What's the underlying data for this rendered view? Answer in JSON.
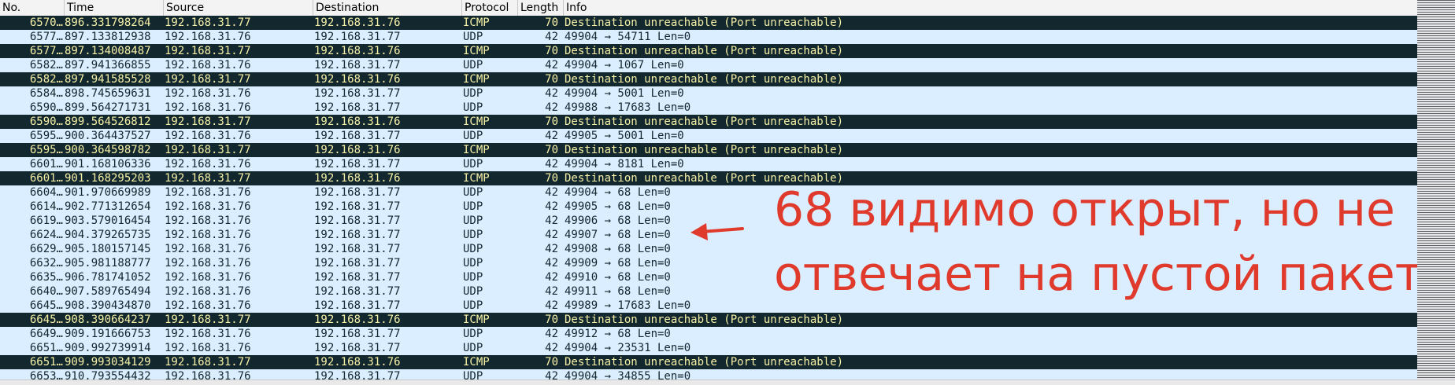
{
  "columns": {
    "no": "No.",
    "time": "Time",
    "source": "Source",
    "destination": "Destination",
    "protocol": "Protocol",
    "length": "Length",
    "info": "Info"
  },
  "packets": [
    {
      "no": "6570…",
      "time": "896.331798264",
      "source": "192.168.31.77",
      "destination": "192.168.31.76",
      "protocol": "ICMP",
      "length": "70",
      "info": "Destination unreachable (Port unreachable)"
    },
    {
      "no": "6577…",
      "time": "897.133812938",
      "source": "192.168.31.76",
      "destination": "192.168.31.77",
      "protocol": "UDP",
      "length": "42",
      "info": "49904 → 54711 Len=0"
    },
    {
      "no": "6577…",
      "time": "897.134008487",
      "source": "192.168.31.77",
      "destination": "192.168.31.76",
      "protocol": "ICMP",
      "length": "70",
      "info": "Destination unreachable (Port unreachable)"
    },
    {
      "no": "6582…",
      "time": "897.941366855",
      "source": "192.168.31.76",
      "destination": "192.168.31.77",
      "protocol": "UDP",
      "length": "42",
      "info": "49904 → 1067 Len=0"
    },
    {
      "no": "6582…",
      "time": "897.941585528",
      "source": "192.168.31.77",
      "destination": "192.168.31.76",
      "protocol": "ICMP",
      "length": "70",
      "info": "Destination unreachable (Port unreachable)"
    },
    {
      "no": "6584…",
      "time": "898.745659631",
      "source": "192.168.31.76",
      "destination": "192.168.31.77",
      "protocol": "UDP",
      "length": "42",
      "info": "49904 → 5001 Len=0"
    },
    {
      "no": "6590…",
      "time": "899.564271731",
      "source": "192.168.31.76",
      "destination": "192.168.31.77",
      "protocol": "UDP",
      "length": "42",
      "info": "49988 → 17683 Len=0"
    },
    {
      "no": "6590…",
      "time": "899.564526812",
      "source": "192.168.31.77",
      "destination": "192.168.31.76",
      "protocol": "ICMP",
      "length": "70",
      "info": "Destination unreachable (Port unreachable)"
    },
    {
      "no": "6595…",
      "time": "900.364437527",
      "source": "192.168.31.76",
      "destination": "192.168.31.77",
      "protocol": "UDP",
      "length": "42",
      "info": "49905 → 5001 Len=0"
    },
    {
      "no": "6595…",
      "time": "900.364598782",
      "source": "192.168.31.77",
      "destination": "192.168.31.76",
      "protocol": "ICMP",
      "length": "70",
      "info": "Destination unreachable (Port unreachable)"
    },
    {
      "no": "6601…",
      "time": "901.168106336",
      "source": "192.168.31.76",
      "destination": "192.168.31.77",
      "protocol": "UDP",
      "length": "42",
      "info": "49904 → 8181 Len=0"
    },
    {
      "no": "6601…",
      "time": "901.168295203",
      "source": "192.168.31.77",
      "destination": "192.168.31.76",
      "protocol": "ICMP",
      "length": "70",
      "info": "Destination unreachable (Port unreachable)"
    },
    {
      "no": "6604…",
      "time": "901.970669989",
      "source": "192.168.31.76",
      "destination": "192.168.31.77",
      "protocol": "UDP",
      "length": "42",
      "info": "49904 → 68 Len=0"
    },
    {
      "no": "6614…",
      "time": "902.771312654",
      "source": "192.168.31.76",
      "destination": "192.168.31.77",
      "protocol": "UDP",
      "length": "42",
      "info": "49905 → 68 Len=0"
    },
    {
      "no": "6619…",
      "time": "903.579016454",
      "source": "192.168.31.76",
      "destination": "192.168.31.77",
      "protocol": "UDP",
      "length": "42",
      "info": "49906 → 68 Len=0"
    },
    {
      "no": "6624…",
      "time": "904.379265735",
      "source": "192.168.31.76",
      "destination": "192.168.31.77",
      "protocol": "UDP",
      "length": "42",
      "info": "49907 → 68 Len=0"
    },
    {
      "no": "6629…",
      "time": "905.180157145",
      "source": "192.168.31.76",
      "destination": "192.168.31.77",
      "protocol": "UDP",
      "length": "42",
      "info": "49908 → 68 Len=0"
    },
    {
      "no": "6632…",
      "time": "905.981188777",
      "source": "192.168.31.76",
      "destination": "192.168.31.77",
      "protocol": "UDP",
      "length": "42",
      "info": "49909 → 68 Len=0"
    },
    {
      "no": "6635…",
      "time": "906.781741052",
      "source": "192.168.31.76",
      "destination": "192.168.31.77",
      "protocol": "UDP",
      "length": "42",
      "info": "49910 → 68 Len=0"
    },
    {
      "no": "6640…",
      "time": "907.589765494",
      "source": "192.168.31.76",
      "destination": "192.168.31.77",
      "protocol": "UDP",
      "length": "42",
      "info": "49911 → 68 Len=0"
    },
    {
      "no": "6645…",
      "time": "908.390434870",
      "source": "192.168.31.76",
      "destination": "192.168.31.77",
      "protocol": "UDP",
      "length": "42",
      "info": "49989 → 17683 Len=0"
    },
    {
      "no": "6645…",
      "time": "908.390664237",
      "source": "192.168.31.77",
      "destination": "192.168.31.76",
      "protocol": "ICMP",
      "length": "70",
      "info": "Destination unreachable (Port unreachable)"
    },
    {
      "no": "6649…",
      "time": "909.191666753",
      "source": "192.168.31.76",
      "destination": "192.168.31.77",
      "protocol": "UDP",
      "length": "42",
      "info": "49912 → 68 Len=0"
    },
    {
      "no": "6651…",
      "time": "909.992739914",
      "source": "192.168.31.76",
      "destination": "192.168.31.77",
      "protocol": "UDP",
      "length": "42",
      "info": "49904 → 23531 Len=0"
    },
    {
      "no": "6651…",
      "time": "909.993034129",
      "source": "192.168.31.77",
      "destination": "192.168.31.76",
      "protocol": "ICMP",
      "length": "70",
      "info": "Destination unreachable (Port unreachable)"
    },
    {
      "no": "6653…",
      "time": "910.793554432",
      "source": "192.168.31.76",
      "destination": "192.168.31.77",
      "protocol": "UDP",
      "length": "42",
      "info": "49904 → 34855 Len=0"
    }
  ],
  "annotation": {
    "line1": "68 видимо открыт, но не",
    "line2": "отвечает на пустой пакет"
  },
  "colors": {
    "udp_row_bg": "#daeeff",
    "udp_row_fg": "#12272e",
    "icmp_row_bg": "#12272e",
    "icmp_row_fg": "#f7f1a7",
    "annotation": "#e03a2c"
  }
}
